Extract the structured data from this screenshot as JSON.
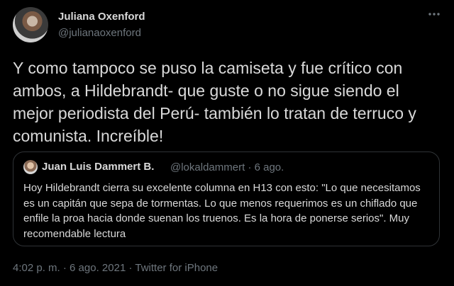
{
  "author": {
    "display_name": "Juliana Oxenford",
    "handle": "@julianaoxenford"
  },
  "tweet": {
    "text": "Y como tampoco se puso la camiseta y fue crítico con ambos, a Hildebrandt- que guste o no sigue siendo el mejor periodista del Perú- también lo tratan de terruco y comunista. Increíble!"
  },
  "quoted": {
    "display_name": "Juan Luis Dammert B.",
    "handle": "@lokaldammert",
    "separator": "·",
    "date": "6 ago.",
    "text": "Hoy Hildebrandt cierra su excelente columna en H13 con esto: \"Lo que necesitamos es un capitán que sepa de tormentas. Lo que menos requerimos es un chiflado que enfile la proa hacia donde suenan los truenos. Es la hora de ponerse serios\". Muy recomendable lectura"
  },
  "footer": {
    "time": "4:02 p. m.",
    "separator": "·",
    "date": "6 ago. 2021",
    "source": "Twitter for iPhone"
  },
  "icons": {
    "more": "more-horizontal-icon"
  },
  "colors": {
    "background": "#000000",
    "text": "#d9d9d9",
    "secondary": "#6e767d",
    "border": "#2f3336"
  }
}
